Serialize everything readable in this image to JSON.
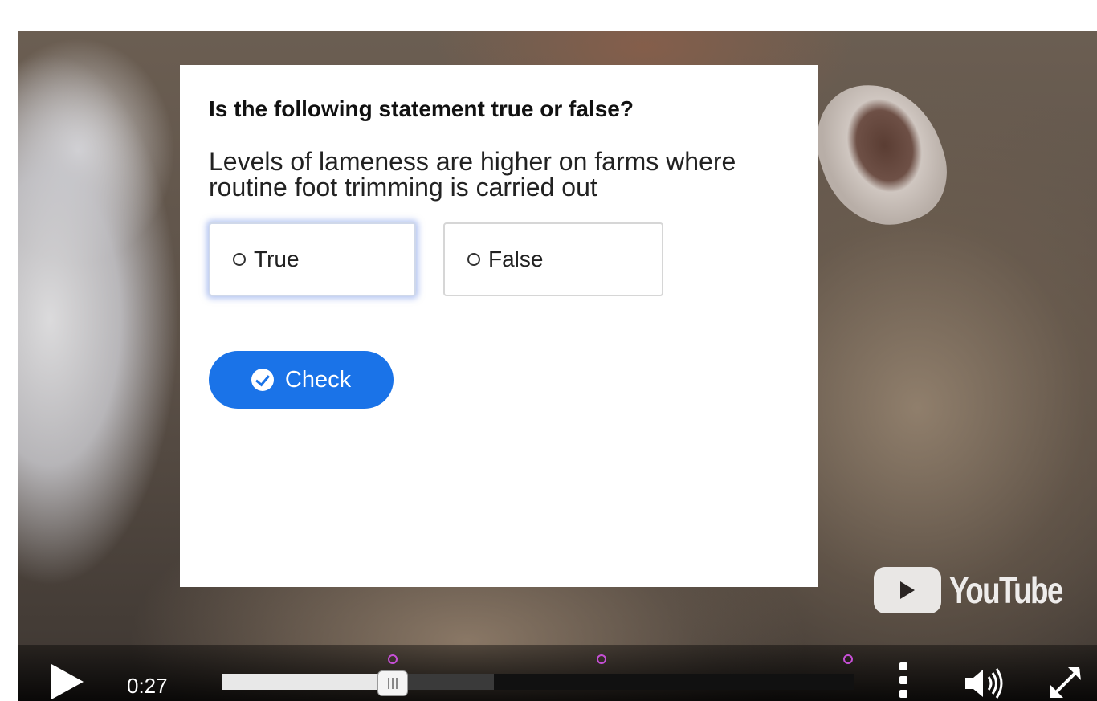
{
  "quiz": {
    "title": "Is the following statement true or false?",
    "statement": "Levels of lameness are higher on farms where routine foot trimming is carried out",
    "options": [
      {
        "label": "True",
        "focused": true
      },
      {
        "label": "False",
        "focused": false
      }
    ],
    "check_label": "Check",
    "accent_color": "#1a73e8"
  },
  "player": {
    "brand": "YouTube",
    "current_time": "0:27",
    "progress_played_fraction": 0.27,
    "progress_buffered_fraction": 0.43,
    "marker_positions_fraction": [
      0.27,
      0.6,
      0.99
    ],
    "marker_color": "#c64fd6",
    "icons": [
      "play-icon",
      "more-vertical-icon",
      "volume-icon",
      "fullscreen-icon"
    ]
  }
}
